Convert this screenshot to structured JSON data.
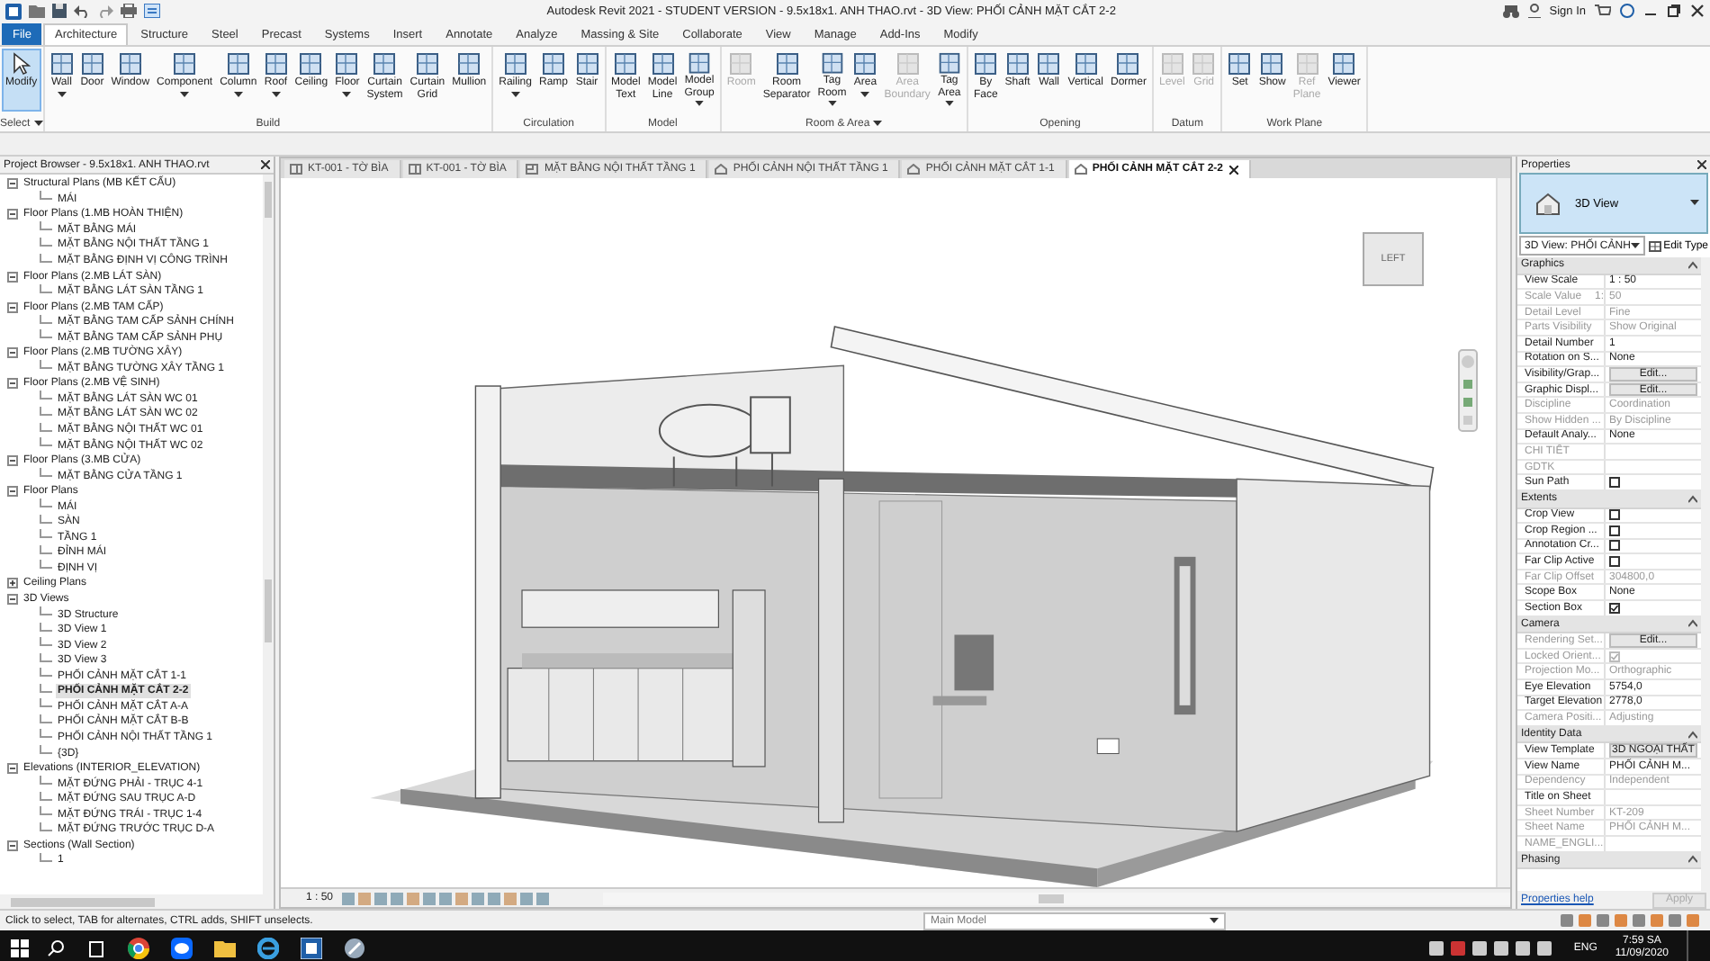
{
  "title_bar": {
    "title": "Autodesk Revit 2021 - STUDENT VERSION - 9.5x18x1. ANH THAO.rvt - 3D View: PHỐI CẢNH MẶT CẮT 2-2",
    "sign_in": "Sign In"
  },
  "ribbon_tabs": [
    {
      "label": "File",
      "kind": "file",
      "selected": false
    },
    {
      "label": "Architecture",
      "kind": "tab",
      "selected": true
    },
    {
      "label": "Structure",
      "kind": "tab",
      "selected": false
    },
    {
      "label": "Steel",
      "kind": "tab",
      "selected": false
    },
    {
      "label": "Precast",
      "kind": "tab",
      "selected": false
    },
    {
      "label": "Systems",
      "kind": "tab",
      "selected": false
    },
    {
      "label": "Insert",
      "kind": "tab",
      "selected": false
    },
    {
      "label": "Annotate",
      "kind": "tab",
      "selected": false
    },
    {
      "label": "Analyze",
      "kind": "tab",
      "selected": false
    },
    {
      "label": "Massing & Site",
      "kind": "tab",
      "selected": false
    },
    {
      "label": "Collaborate",
      "kind": "tab",
      "selected": false
    },
    {
      "label": "View",
      "kind": "tab",
      "selected": false
    },
    {
      "label": "Manage",
      "kind": "tab",
      "selected": false
    },
    {
      "label": "Add-Ins",
      "kind": "tab",
      "selected": false
    },
    {
      "label": "Modify",
      "kind": "tab",
      "selected": false
    }
  ],
  "ribbon_groups": [
    {
      "label": "Select",
      "has_menu": true,
      "tools": [
        {
          "label": "Modify",
          "menu": false,
          "disabled": false,
          "selected": true
        }
      ]
    },
    {
      "label": "Build",
      "has_menu": false,
      "tools": [
        {
          "label": "Wall",
          "menu": true,
          "disabled": false,
          "selected": false
        },
        {
          "label": "Door",
          "menu": false,
          "disabled": false,
          "selected": false
        },
        {
          "label": "Window",
          "menu": false,
          "disabled": false,
          "selected": false
        },
        {
          "label": "Component",
          "menu": true,
          "disabled": false,
          "selected": false
        },
        {
          "label": "Column",
          "menu": true,
          "disabled": false,
          "selected": false
        },
        {
          "label": "Roof",
          "menu": true,
          "disabled": false,
          "selected": false
        },
        {
          "label": "Ceiling",
          "menu": false,
          "disabled": false,
          "selected": false
        },
        {
          "label": "Floor",
          "menu": true,
          "disabled": false,
          "selected": false
        },
        {
          "label": "Curtain System",
          "menu": false,
          "disabled": false,
          "selected": false
        },
        {
          "label": "Curtain Grid",
          "menu": false,
          "disabled": false,
          "selected": false
        },
        {
          "label": "Mullion",
          "menu": false,
          "disabled": false,
          "selected": false
        }
      ]
    },
    {
      "label": "Circulation",
      "has_menu": false,
      "tools": [
        {
          "label": "Railing",
          "menu": true,
          "disabled": false,
          "selected": false
        },
        {
          "label": "Ramp",
          "menu": false,
          "disabled": false,
          "selected": false
        },
        {
          "label": "Stair",
          "menu": false,
          "disabled": false,
          "selected": false
        }
      ]
    },
    {
      "label": "Model",
      "has_menu": false,
      "tools": [
        {
          "label": "Model Text",
          "menu": false,
          "disabled": false,
          "selected": false
        },
        {
          "label": "Model Line",
          "menu": false,
          "disabled": false,
          "selected": false
        },
        {
          "label": "Model Group",
          "menu": true,
          "disabled": false,
          "selected": false
        }
      ]
    },
    {
      "label": "Room & Area",
      "has_menu": true,
      "tools": [
        {
          "label": "Room",
          "menu": false,
          "disabled": true,
          "selected": false
        },
        {
          "label": "Room Separator",
          "menu": false,
          "disabled": false,
          "selected": false
        },
        {
          "label": "Tag Room",
          "menu": true,
          "disabled": false,
          "selected": false
        },
        {
          "label": "Area",
          "menu": true,
          "disabled": false,
          "selected": false
        },
        {
          "label": "Area Boundary",
          "menu": false,
          "disabled": true,
          "selected": false
        },
        {
          "label": "Tag Area",
          "menu": true,
          "disabled": false,
          "selected": false
        }
      ]
    },
    {
      "label": "Opening",
      "has_menu": false,
      "tools": [
        {
          "label": "By Face",
          "menu": false,
          "disabled": false,
          "selected": false
        },
        {
          "label": "Shaft",
          "menu": false,
          "disabled": false,
          "selected": false
        },
        {
          "label": "Wall",
          "menu": false,
          "disabled": false,
          "selected": false
        },
        {
          "label": "Vertical",
          "menu": false,
          "disabled": false,
          "selected": false
        },
        {
          "label": "Dormer",
          "menu": false,
          "disabled": false,
          "selected": false
        }
      ]
    },
    {
      "label": "Datum",
      "has_menu": false,
      "tools": [
        {
          "label": "Level",
          "menu": false,
          "disabled": true,
          "selected": false
        },
        {
          "label": "Grid",
          "menu": false,
          "disabled": true,
          "selected": false
        }
      ]
    },
    {
      "label": "Work Plane",
      "has_menu": false,
      "tools": [
        {
          "label": "Set",
          "menu": false,
          "disabled": false,
          "selected": false
        },
        {
          "label": "Show",
          "menu": false,
          "disabled": false,
          "selected": false
        },
        {
          "label": "Ref Plane",
          "menu": false,
          "disabled": true,
          "selected": false
        },
        {
          "label": "Viewer",
          "menu": false,
          "disabled": false,
          "selected": false
        }
      ]
    }
  ],
  "project_browser": {
    "title": "Project Browser - 9.5x18x1. ANH THAO.rvt",
    "tree": [
      {
        "label": "Structural Plans (MB KẾT CẤU)",
        "expanded": true,
        "selected": false,
        "children": [
          {
            "label": "MÁI",
            "selected": false
          }
        ]
      },
      {
        "label": "Floor Plans (1.MB HOÀN THIỆN)",
        "expanded": true,
        "selected": false,
        "children": [
          {
            "label": "MẶT BẰNG MÁI",
            "selected": false
          },
          {
            "label": "MẶT BẰNG NỘI THẤT TẦNG 1",
            "selected": false
          },
          {
            "label": "MẶT BẰNG ĐỊNH VỊ CÔNG TRÌNH",
            "selected": false
          }
        ]
      },
      {
        "label": "Floor Plans (2.MB LÁT SÀN)",
        "expanded": true,
        "selected": false,
        "children": [
          {
            "label": "MẶT BẰNG LÁT SÀN TẦNG 1",
            "selected": false
          }
        ]
      },
      {
        "label": "Floor Plans (2.MB TAM CẤP)",
        "expanded": true,
        "selected": false,
        "children": [
          {
            "label": "MẶT BẰNG TAM CẤP SẢNH CHÍNH",
            "selected": false
          },
          {
            "label": "MẶT BẰNG TAM CẤP SẢNH PHỤ",
            "selected": false
          }
        ]
      },
      {
        "label": "Floor Plans (2.MB TƯỜNG XÂY)",
        "expanded": true,
        "selected": false,
        "children": [
          {
            "label": "MẶT BẰNG TƯỜNG XÂY TẦNG 1",
            "selected": false
          }
        ]
      },
      {
        "label": "Floor Plans (2.MB VỆ SINH)",
        "expanded": true,
        "selected": false,
        "children": [
          {
            "label": "MẶT BẰNG LÁT SÀN WC 01",
            "selected": false
          },
          {
            "label": "MẶT BẰNG LÁT SÀN WC 02",
            "selected": false
          },
          {
            "label": "MẶT BẰNG NỘI THẤT WC 01",
            "selected": false
          },
          {
            "label": "MẶT BẰNG NỘI THẤT WC 02",
            "selected": false
          }
        ]
      },
      {
        "label": "Floor Plans (3.MB CỬA)",
        "expanded": true,
        "selected": false,
        "children": [
          {
            "label": "MẶT BẰNG CỬA TẦNG 1",
            "selected": false
          }
        ]
      },
      {
        "label": "Floor Plans",
        "expanded": true,
        "selected": false,
        "children": [
          {
            "label": "MÁI",
            "selected": false
          },
          {
            "label": "SÀN",
            "selected": false
          },
          {
            "label": "TẦNG 1",
            "selected": false
          },
          {
            "label": "ĐỈNH MÁI",
            "selected": false
          },
          {
            "label": "ĐỊNH VỊ",
            "selected": false
          }
        ]
      },
      {
        "label": "Ceiling Plans",
        "expanded": false,
        "selected": false
      },
      {
        "label": "3D Views",
        "expanded": true,
        "selected": false,
        "children": [
          {
            "label": "3D Structure",
            "selected": false
          },
          {
            "label": "3D View 1",
            "selected": false
          },
          {
            "label": "3D View 2",
            "selected": false
          },
          {
            "label": "3D View 3",
            "selected": false
          },
          {
            "label": "PHỐI CẢNH MẶT CẮT 1-1",
            "selected": false
          },
          {
            "label": "PHỐI CẢNH MẶT CẮT 2-2",
            "selected": true
          },
          {
            "label": "PHỐI CẢNH MẶT CẮT A-A",
            "selected": false
          },
          {
            "label": "PHỐI CẢNH MẶT CẮT B-B",
            "selected": false
          },
          {
            "label": "PHỐI CẢNH NỘI THẤT TẦNG 1",
            "selected": false
          },
          {
            "label": "{3D}",
            "selected": false
          }
        ]
      },
      {
        "label": "Elevations (INTERIOR_ELEVATION)",
        "expanded": true,
        "selected": false,
        "children": [
          {
            "label": "MẶT ĐỨNG PHẢI - TRỤC 4-1",
            "selected": false
          },
          {
            "label": "MẶT ĐỨNG SAU TRỤC A-D",
            "selected": false
          },
          {
            "label": "MẶT ĐỨNG TRÁI - TRỤC 1-4",
            "selected": false
          },
          {
            "label": "MẶT ĐỨNG TRƯỚC TRỤC D-A",
            "selected": false
          }
        ]
      },
      {
        "label": "Sections (Wall Section)",
        "expanded": true,
        "selected": false,
        "children": [
          {
            "label": "1",
            "selected": false
          }
        ]
      }
    ]
  },
  "view_tabs": [
    {
      "label": "KT-001 - TỜ BÌA",
      "kind": "sheet",
      "selected": false
    },
    {
      "label": "KT-001 - TỜ BÌA",
      "kind": "sheet",
      "selected": false
    },
    {
      "label": "MẶT BẰNG NỘI THẤT TẦNG 1",
      "kind": "plan",
      "selected": false
    },
    {
      "label": "PHỐI CẢNH NỘI THẤT TẦNG 1",
      "kind": "perspective",
      "selected": false
    },
    {
      "label": "PHỐI CẢNH MẶT CẮT 1-1",
      "kind": "perspective",
      "selected": false
    },
    {
      "label": "PHỐI CẢNH MẶT CẮT 2-2",
      "kind": "perspective",
      "selected": true
    }
  ],
  "view": {
    "cube_label": "LEFT",
    "scale": "1 : 50"
  },
  "properties": {
    "title": "Properties",
    "type_name": "3D View",
    "type_selector": "3D View: PHỐI CẢNH",
    "edit_type": "Edit Type",
    "sections": [
      {
        "label": "Graphics",
        "rows": [
          {
            "name": "View Scale",
            "kind": "text",
            "value": "1 : 50",
            "disabled": false
          },
          {
            "name": "Scale Value",
            "unit": "1:",
            "kind": "text",
            "value": "50",
            "disabled": true
          },
          {
            "name": "Detail Level",
            "kind": "text",
            "value": "Fine",
            "disabled": true
          },
          {
            "name": "Parts Visibility",
            "kind": "text",
            "value": "Show Original",
            "disabled": true
          },
          {
            "name": "Detail Number",
            "kind": "text",
            "value": "1",
            "disabled": false
          },
          {
            "name": "Rotation on S...",
            "kind": "text",
            "value": "None",
            "disabled": false
          },
          {
            "name": "Visibility/Grap...",
            "kind": "button",
            "value": "Edit...",
            "disabled": false
          },
          {
            "name": "Graphic Displ...",
            "kind": "button",
            "value": "Edit...",
            "disabled": false
          },
          {
            "name": "Discipline",
            "kind": "text",
            "value": "Coordination",
            "disabled": true
          },
          {
            "name": "Show Hidden ...",
            "kind": "text",
            "value": "By Discipline",
            "disabled": true
          },
          {
            "name": "Default Analy...",
            "kind": "text",
            "value": "None",
            "disabled": false
          },
          {
            "name": "CHI TIẾT",
            "kind": "text",
            "disabled": true
          },
          {
            "name": "GDTK",
            "kind": "text",
            "disabled": true
          },
          {
            "name": "Sun Path",
            "kind": "checkbox",
            "checked": false,
            "disabled": false
          }
        ]
      },
      {
        "label": "Extents",
        "rows": [
          {
            "name": "Crop View",
            "kind": "checkbox",
            "checked": false,
            "disabled": false
          },
          {
            "name": "Crop Region ...",
            "kind": "checkbox",
            "checked": false,
            "disabled": false
          },
          {
            "name": "Annotation Cr...",
            "kind": "checkbox",
            "checked": false,
            "disabled": false
          },
          {
            "name": "Far Clip Active",
            "kind": "checkbox",
            "checked": false,
            "disabled": false
          },
          {
            "name": "Far Clip Offset",
            "kind": "text",
            "value": "304800,0",
            "disabled": true
          },
          {
            "name": "Scope Box",
            "kind": "text",
            "value": "None",
            "disabled": false
          },
          {
            "name": "Section Box",
            "kind": "checkbox",
            "checked": true,
            "disabled": false
          }
        ]
      },
      {
        "label": "Camera",
        "rows": [
          {
            "name": "Rendering Set...",
            "kind": "button",
            "value": "Edit...",
            "disabled": true
          },
          {
            "name": "Locked Orient...",
            "kind": "checkbox",
            "checked": true,
            "disabled": true
          },
          {
            "name": "Projection Mo...",
            "kind": "text",
            "value": "Orthographic",
            "disabled": true
          },
          {
            "name": "Eye Elevation",
            "kind": "text",
            "value": "5754,0",
            "disabled": false
          },
          {
            "name": "Target Elevation",
            "kind": "text",
            "value": "2778,0",
            "disabled": false
          },
          {
            "name": "Camera Positi...",
            "kind": "text",
            "value": "Adjusting",
            "disabled": true
          }
        ]
      },
      {
        "label": "Identity Data",
        "rows": [
          {
            "name": "View Template",
            "kind": "button",
            "value": "3D NGOẠI THẤT",
            "disabled": false
          },
          {
            "name": "View Name",
            "kind": "text",
            "value": "PHỐI CẢNH M...",
            "disabled": false
          },
          {
            "name": "Dependency",
            "kind": "text",
            "value": "Independent",
            "disabled": true
          },
          {
            "name": "Title on Sheet",
            "kind": "text",
            "disabled": false
          },
          {
            "name": "Sheet Number",
            "kind": "text",
            "value": "KT-209",
            "disabled": true
          },
          {
            "name": "Sheet Name",
            "kind": "text",
            "value": "PHỐI CẢNH M...",
            "disabled": true
          },
          {
            "name": "NAME_ENGLI...",
            "kind": "text",
            "disabled": true
          }
        ]
      },
      {
        "label": "Phasing"
      }
    ],
    "help": "Properties help",
    "apply": "Apply",
    "apply_disabled": true
  },
  "status_bar": {
    "message": "Click to select, TAB for alternates, CTRL adds, SHIFT unselects.",
    "model": "Main Model"
  },
  "taskbar": {
    "language": "ENG",
    "time": "7:59 SA",
    "date": "11/09/2020"
  }
}
